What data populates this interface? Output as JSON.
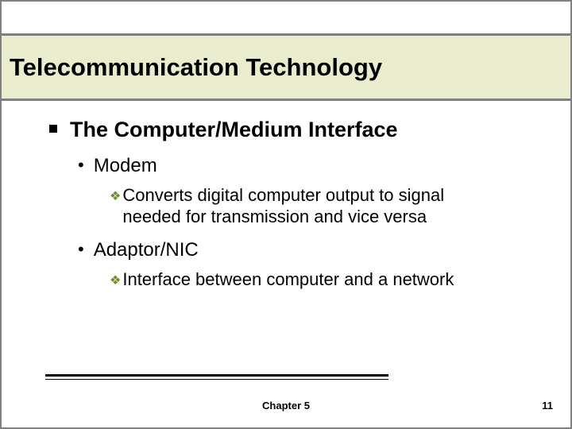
{
  "title": "Telecommunication Technology",
  "section": "The Computer/Medium Interface",
  "items": [
    {
      "label": "Modem",
      "detail": "Converts digital computer output to signal needed for transmission and vice versa"
    },
    {
      "label": "Adaptor/NIC",
      "detail": "Interface between computer and a network"
    }
  ],
  "footer": {
    "chapter": "Chapter 5",
    "page": "11"
  }
}
